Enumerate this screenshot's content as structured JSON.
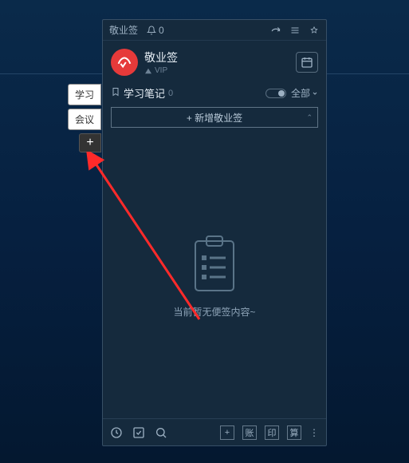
{
  "titlebar": {
    "title": "敬业签",
    "notification_count": "0"
  },
  "header": {
    "app_name": "敬业签",
    "vip_label": "VIP"
  },
  "side_tabs": {
    "tab1": "学习",
    "tab2": "会议",
    "add": "+"
  },
  "section": {
    "name": "学习笔记",
    "count": "0",
    "filter_label": "全部"
  },
  "add_button": {
    "label": "+ 新增敬业签"
  },
  "empty_state": {
    "text": "当前暂无便签内容~"
  },
  "footer": {
    "plus": "+",
    "btn1": "账",
    "btn2": "印",
    "btn3": "算"
  }
}
